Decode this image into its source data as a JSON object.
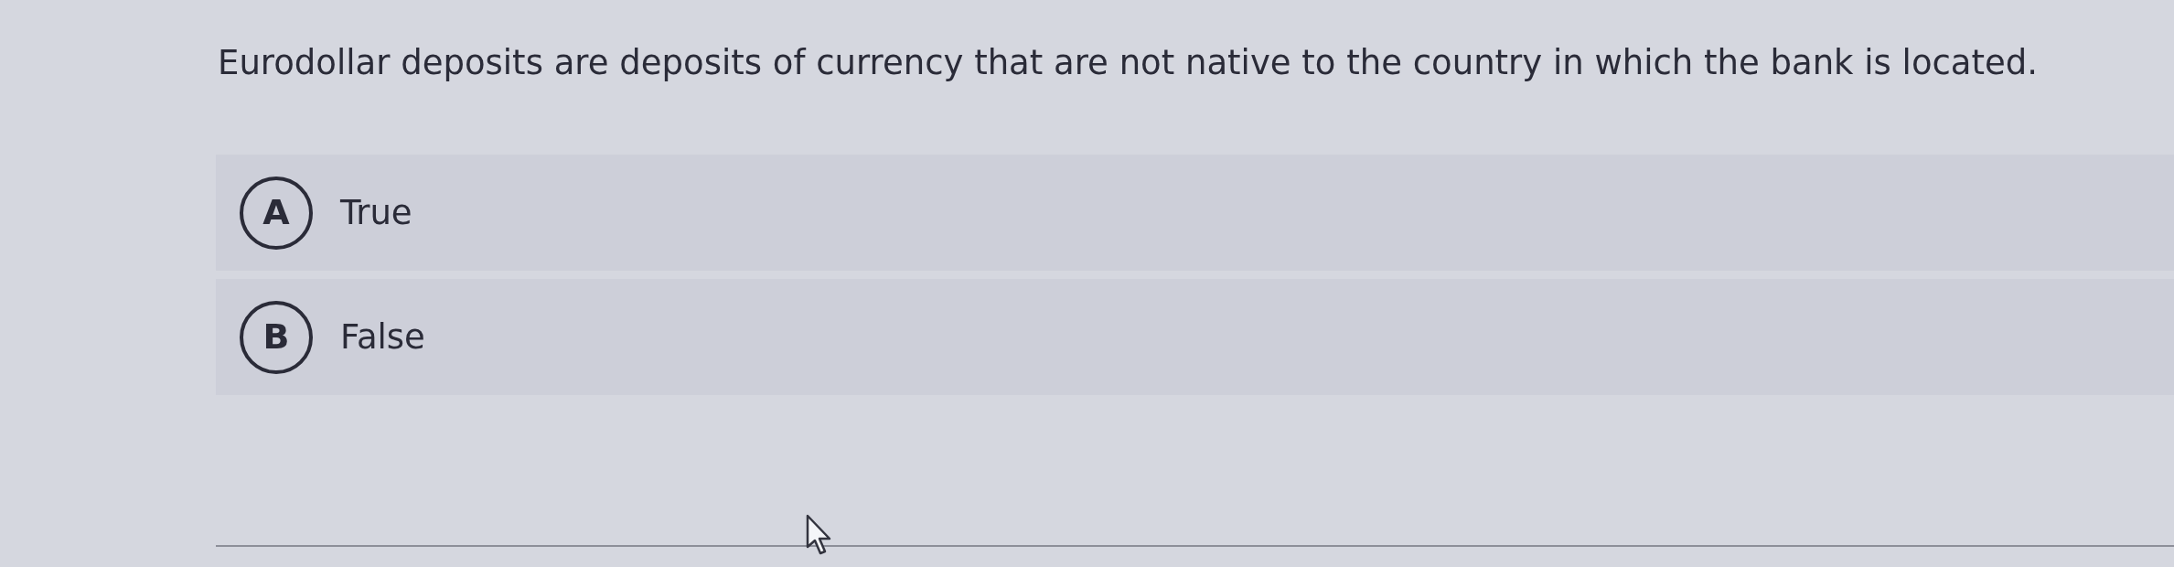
{
  "question": {
    "text": "Eurodollar deposits are deposits of currency that are not native to the country in which the bank is located."
  },
  "options": [
    {
      "letter": "A",
      "label": "True",
      "selected": false
    },
    {
      "letter": "B",
      "label": "False",
      "selected": false
    }
  ]
}
